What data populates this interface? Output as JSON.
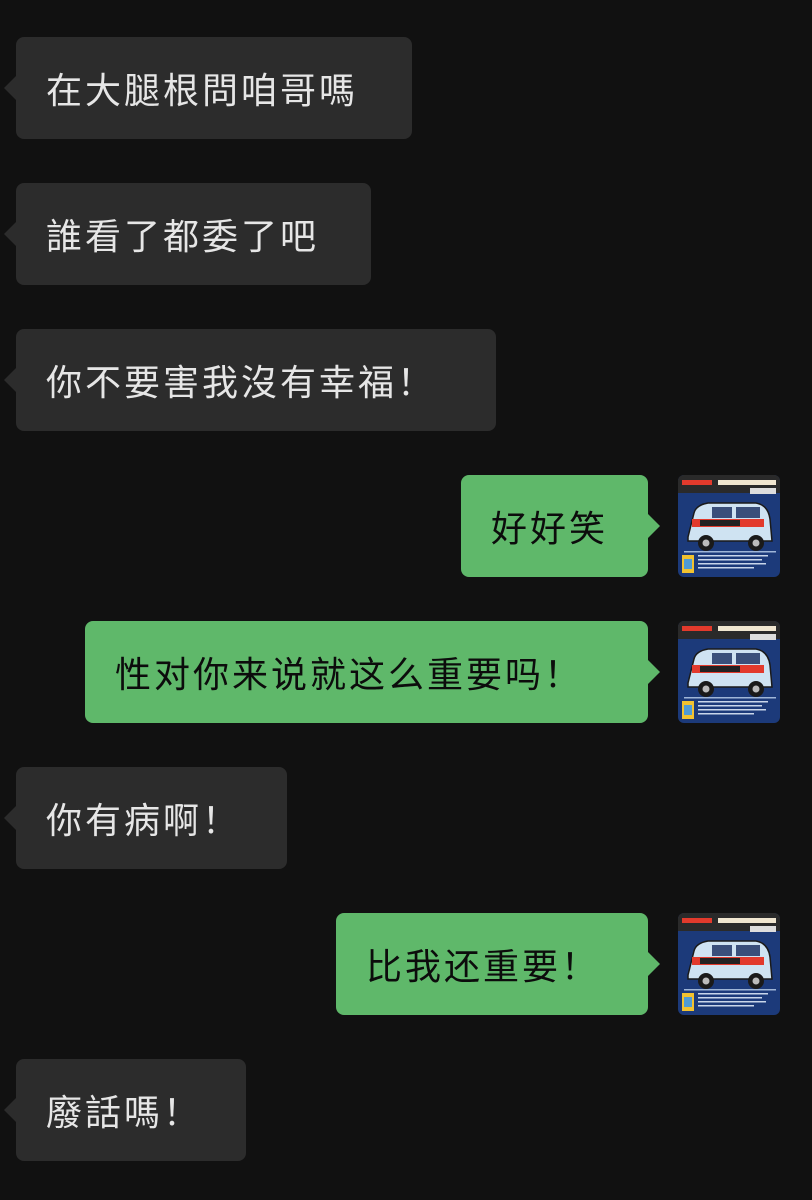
{
  "messages": [
    {
      "side": "incoming",
      "text": "在大腿根問咱哥嗎"
    },
    {
      "side": "incoming",
      "text": "誰看了都委了吧"
    },
    {
      "side": "incoming",
      "text": "你不要害我沒有幸福！"
    },
    {
      "side": "outgoing",
      "text": "好好笑"
    },
    {
      "side": "outgoing",
      "text": "性对你来说就这么重要吗！"
    },
    {
      "side": "incoming",
      "text": "你有病啊！"
    },
    {
      "side": "outgoing",
      "text": "比我还重要！"
    },
    {
      "side": "incoming",
      "text": "廢話嗎！"
    }
  ],
  "avatar": {
    "icon": "van-album-cover-icon",
    "colors": {
      "sky": "#1c3a7a",
      "van": "#cfe3f2",
      "stripe": "#e23a2c",
      "accent": "#f2c230"
    }
  },
  "colors": {
    "background": "#111111",
    "incoming_bubble": "#2c2c2c",
    "outgoing_bubble": "#5fb86a"
  }
}
